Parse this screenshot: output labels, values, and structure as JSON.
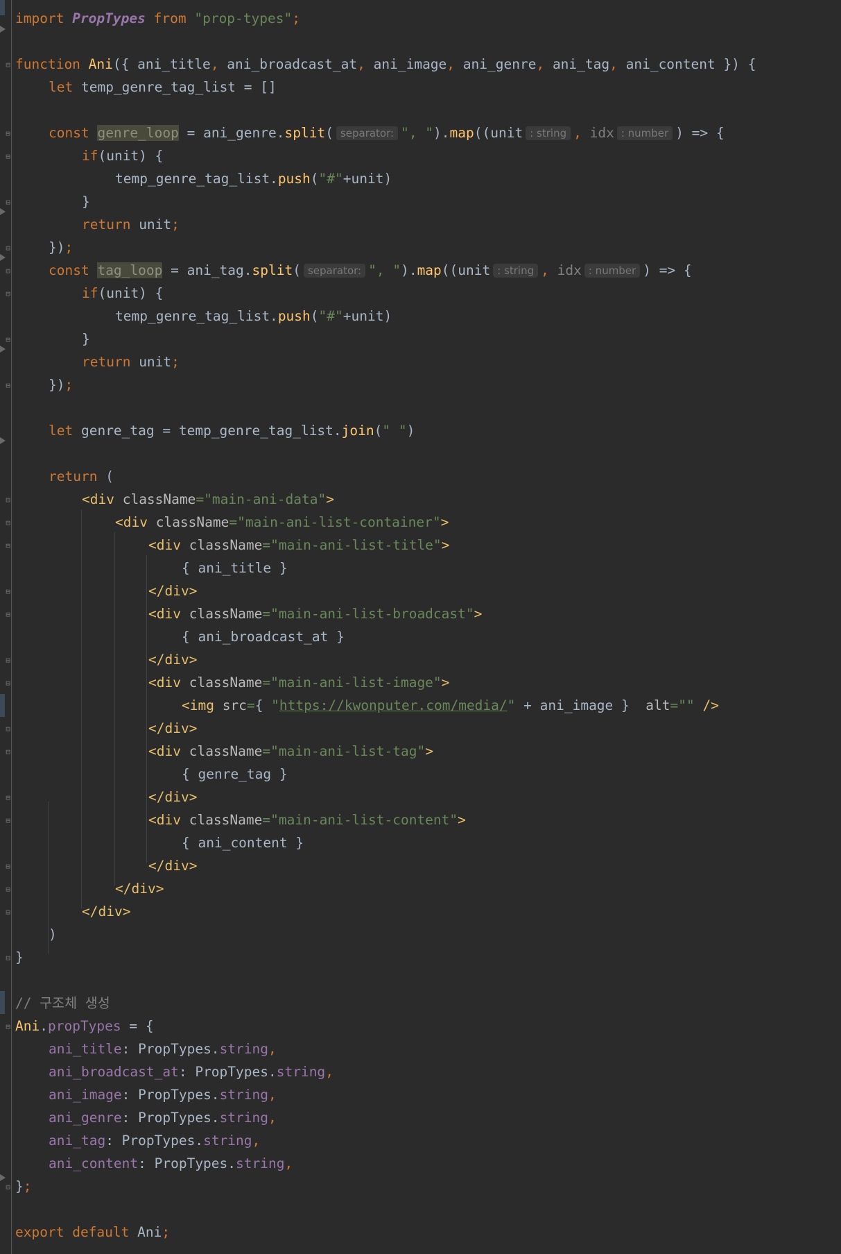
{
  "editor": {
    "lines": {
      "l1": {
        "kw_import": "import",
        "cls": "PropTypes",
        "kw_from": "from",
        "str": "\"prop-types\"",
        "semi": ";"
      },
      "l3": {
        "kw": "function",
        "fn": "Ani",
        "open": "({ ",
        "p1": "ani_title",
        "c1": ", ",
        "p2": "ani_broadcast_at",
        "c2": ", ",
        "p3": "ani_image",
        "c3": ", ",
        "p4": "ani_genre",
        "c4": ", ",
        "p5": "ani_tag",
        "c5": ", ",
        "p6": "ani_content",
        "close": " }) {"
      },
      "l4": {
        "kw": "let",
        "rest": "temp_genre_tag_list = []"
      },
      "l6": {
        "kw": "const",
        "var": "genre_loop",
        "eq": " = ani_genre.",
        "fn_split": "split",
        "p_open": "(",
        "hint_sep": "separator:",
        "str": "\", \"",
        "p_close": ").",
        "fn_map": "map",
        "args_open": "((unit",
        "hint_t1": ": string",
        "comma": ",",
        "idx": " idx",
        "hint_t2": ": number",
        "arrow": ") => {"
      },
      "l7": {
        "kw": "if",
        "rest": "(unit) {"
      },
      "l8": {
        "obj": "temp_genre_tag_list.",
        "fn": "push",
        "open": "(",
        "str": "\"#\"",
        "rest": "+unit)"
      },
      "l9": {
        "text": "}"
      },
      "l10": {
        "kw": "return",
        "rest": " unit",
        "semi": ";"
      },
      "l11": {
        "text": "})",
        "semi": ";"
      },
      "l12": {
        "kw": "const",
        "var": "tag_loop",
        "eq": " = ani_tag.",
        "fn_split": "split",
        "p_open": "(",
        "hint_sep": "separator:",
        "str": "\", \"",
        "p_close": ").",
        "fn_map": "map",
        "args_open": "((unit",
        "hint_t1": ": string",
        "comma": ",",
        "idx": " idx",
        "hint_t2": ": number",
        "arrow": ") => {"
      },
      "l13": {
        "kw": "if",
        "rest": "(unit) {"
      },
      "l14": {
        "obj": "temp_genre_tag_list.",
        "fn": "push",
        "open": "(",
        "str": "\"#\"",
        "rest": "+unit)"
      },
      "l15": {
        "text": "}"
      },
      "l16": {
        "kw": "return",
        "rest": " unit",
        "semi": ";"
      },
      "l17": {
        "text": "})",
        "semi": ";"
      },
      "l19": {
        "kw": "let",
        "rest": " genre_tag = temp_genre_tag_list.",
        "fn": "join",
        "open": "(",
        "str": "\" \"",
        "close": ")"
      },
      "l21": {
        "kw": "return",
        "rest": " ("
      },
      "l22": {
        "tag_open": "<div",
        "attr": " className",
        "eq": "=",
        "str": "\"main-ani-data\"",
        "tag_close": ">"
      },
      "l23": {
        "tag_open": "<div",
        "attr": " className",
        "eq": "=",
        "str": "\"main-ani-list-container\"",
        "tag_close": ">"
      },
      "l24": {
        "tag_open": "<div",
        "attr": " className",
        "eq": "=",
        "str": "\"main-ani-list-title\"",
        "tag_close": ">"
      },
      "l25": {
        "text": "{ ani_title }"
      },
      "l26": {
        "tag": "</div>"
      },
      "l27": {
        "tag_open": "<div",
        "attr": " className",
        "eq": "=",
        "str": "\"main-ani-list-broadcast\"",
        "tag_close": ">"
      },
      "l28": {
        "text": "{ ani_broadcast_at }"
      },
      "l29": {
        "tag": "</div>"
      },
      "l30": {
        "tag_open": "<div",
        "attr": " className",
        "eq": "=",
        "str": "\"main-ani-list-image\"",
        "tag_close": ">"
      },
      "l31": {
        "tag_open": "<img",
        "attr": " src",
        "eq": "=",
        "brace": "{ ",
        "q1": "\"",
        "url": "https://kwonputer.com/media/",
        "q2": "\"",
        "rest": " + ani_image }  ",
        "attr2": "alt",
        "eq2": "=",
        "str2": "\"\"",
        "tag_close": " />"
      },
      "l32": {
        "tag": "</div>"
      },
      "l33": {
        "tag_open": "<div",
        "attr": " className",
        "eq": "=",
        "str": "\"main-ani-list-tag\"",
        "tag_close": ">"
      },
      "l34": {
        "text": "{ genre_tag }"
      },
      "l35": {
        "tag": "</div>"
      },
      "l36": {
        "tag_open": "<div",
        "attr": " className",
        "eq": "=",
        "str": "\"main-ani-list-content\"",
        "tag_close": ">"
      },
      "l37": {
        "text": "{ ani_content }"
      },
      "l38": {
        "tag": "</div>"
      },
      "l39": {
        "tag": "</div>"
      },
      "l40": {
        "tag": "</div>"
      },
      "l41": {
        "text": ")"
      },
      "l42": {
        "text": "}"
      },
      "l44": {
        "comment": "// 구조체 생성"
      },
      "l45": {
        "obj": "Ani",
        "dot": ".",
        "prop": "propTypes",
        "rest": " = {"
      },
      "props": [
        {
          "name": "ani_title",
          "colon": ": PropTypes.",
          "type": "string",
          "comma": ","
        },
        {
          "name": "ani_broadcast_at",
          "colon": ": PropTypes.",
          "type": "string",
          "comma": ","
        },
        {
          "name": "ani_image",
          "colon": ": PropTypes.",
          "type": "string",
          "comma": ","
        },
        {
          "name": "ani_genre",
          "colon": ": PropTypes.",
          "type": "string",
          "comma": ","
        },
        {
          "name": "ani_tag",
          "colon": ": PropTypes.",
          "type": "string",
          "comma": ","
        },
        {
          "name": "ani_content",
          "colon": ": PropTypes.",
          "type": "string",
          "comma": ","
        }
      ],
      "l52": {
        "text": "}",
        "semi": ";"
      },
      "l54": {
        "kw_export": "export",
        "kw_default": "default",
        "rest": " Ani",
        "semi": ";"
      }
    }
  }
}
